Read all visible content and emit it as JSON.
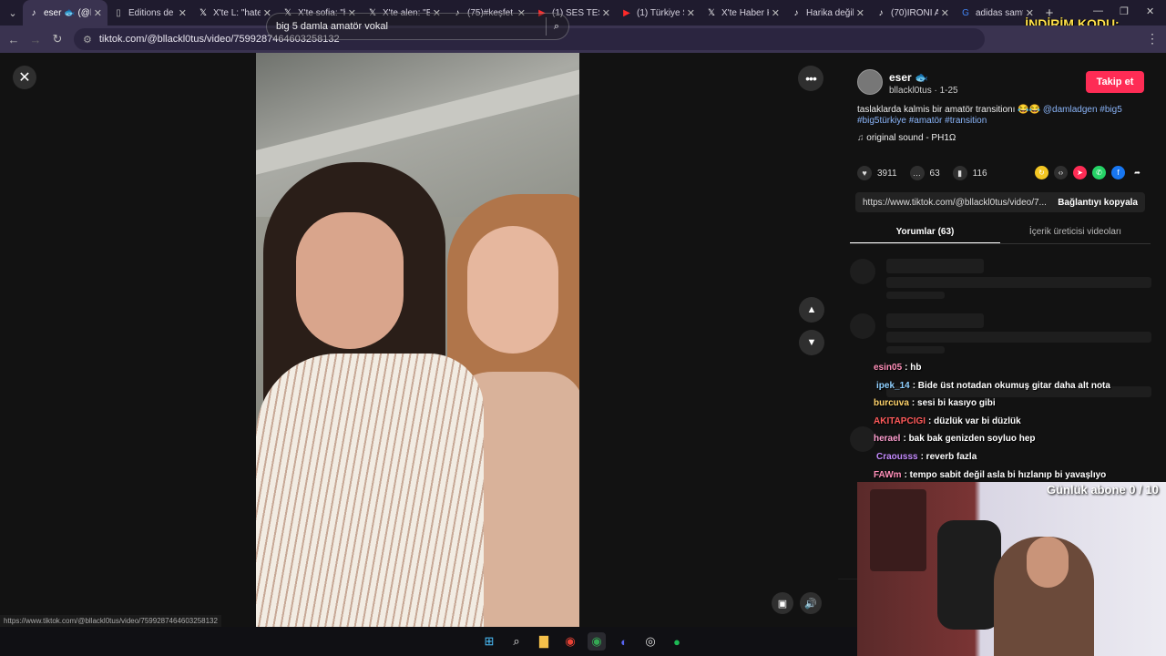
{
  "tabs": [
    {
      "title": "eser 🐟 (@bl",
      "icon": "tiktok-icon",
      "active": true
    },
    {
      "title": "Editions de F",
      "icon": "page-icon"
    },
    {
      "title": "X'te L: \"hate",
      "icon": "x-icon"
    },
    {
      "title": "X'te sofia: \"h",
      "icon": "x-icon"
    },
    {
      "title": "X'te alen: \"B",
      "icon": "x-icon"
    },
    {
      "title": "(75)#keşfet",
      "icon": "tiktok-icon"
    },
    {
      "title": "(1) SES TEST",
      "icon": "youtube-icon"
    },
    {
      "title": "(1) Türkiye S",
      "icon": "youtube-icon"
    },
    {
      "title": "X'te Haber K",
      "icon": "x-icon"
    },
    {
      "title": "Harika değil",
      "icon": "tiktok-icon"
    },
    {
      "title": "(70)İRONİ A",
      "icon": "tiktok-icon"
    },
    {
      "title": "adidas samt",
      "icon": "google-icon"
    }
  ],
  "address": {
    "url": "tiktok.com/@bllackl0tus/video/7599287464603258132"
  },
  "overlay": {
    "watermark": "İNDİRİM KODU: PERVER",
    "sub_goal": "Günlük abone 0 / 10"
  },
  "video": {
    "search_query": "big 5 damla amatör vokal"
  },
  "author": {
    "name": "eser 🐟",
    "handle": "bllackl0tus · 1-25",
    "follow_label": "Takip et",
    "caption": "taslaklarda kalmis bir amatör transitionı 😂😂",
    "mention": "@damladgen",
    "hashtags": "#big5 #big5türkiye #amatör #transition",
    "sound": "original sound - PH1Ω"
  },
  "stats": {
    "likes": "3911",
    "comments": "63",
    "saves": "116"
  },
  "link": {
    "url": "https://www.tiktok.com/@bllackl0tus/video/7...",
    "copy_label": "Bağlantıyı kopyala"
  },
  "panel_tabs": [
    {
      "label": "Yorumlar (63)",
      "active": true
    },
    {
      "label": "İçerik üreticisi videoları"
    }
  ],
  "chat": [
    {
      "name": "esin05",
      "text": ": hb",
      "color": "#ff8fb8"
    },
    {
      "name": "ipek_14",
      "text": ": Bide üst notadan okumuş gitar daha alt nota",
      "color": "#8fd0ff"
    },
    {
      "name": "burcuva",
      "text": ": sesi bi kasıyo gibi",
      "color": "#ffd36b"
    },
    {
      "name": "AKITAPCIGI",
      "text": ": düzlük var bi düzlük",
      "color": "#ff5a5a"
    },
    {
      "name": "herael",
      "text": ": bak bak genizden soyluo hep",
      "color": "#ff9fd0"
    },
    {
      "name": "Craousss",
      "text": ": reverb fazla",
      "color": "#c58cff"
    },
    {
      "name": "FAWm",
      "text": ": tempo sabit değil asla bi hızlanıp bi yavaşlıyo",
      "color": "#ff8fb8"
    }
  ],
  "status_url": "https://www.tiktok.com/@bllackl0tus/video/7599287464603258132",
  "colors": {
    "accent": "#fe2c55",
    "link": "#8ab4f8"
  }
}
